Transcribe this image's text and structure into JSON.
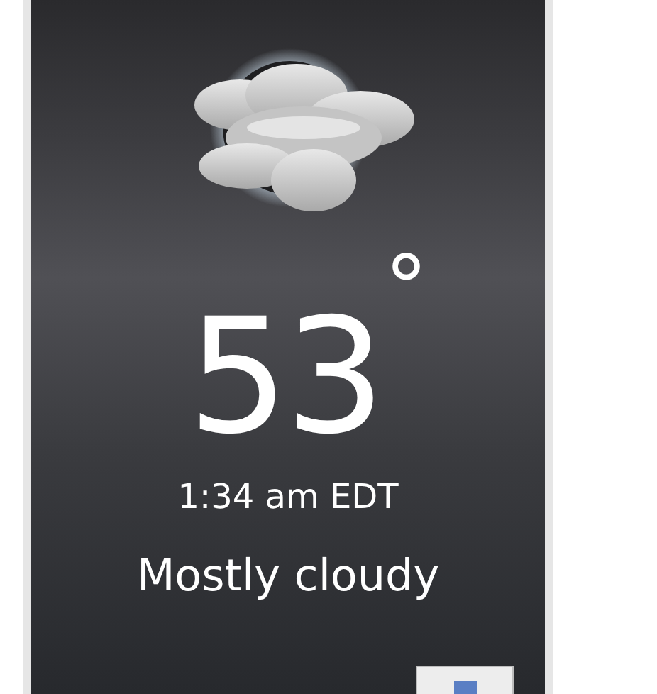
{
  "weather": {
    "temperature": "53",
    "degree_symbol": "°",
    "time": "1:34 am EDT",
    "condition": "Mostly cloudy"
  }
}
